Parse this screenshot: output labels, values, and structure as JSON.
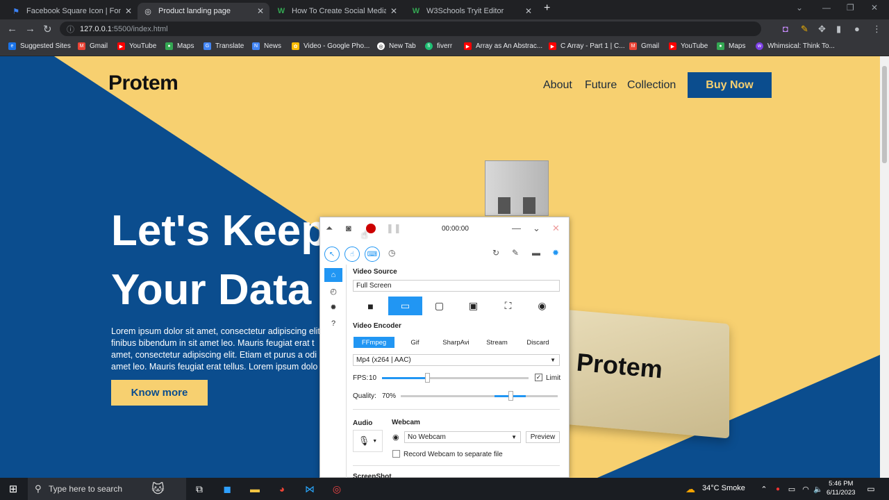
{
  "browser": {
    "tabs": [
      {
        "title": "Facebook Square Icon | Font Awe",
        "icon": "flag-icon",
        "color": "#3b82f6"
      },
      {
        "title": "Product landing page",
        "icon": "globe-icon",
        "color": "#bdc1c6"
      },
      {
        "title": "How To Create Social Media Butt",
        "icon": "w3-icon",
        "color": "#34a853"
      },
      {
        "title": "W3Schools Tryit Editor",
        "icon": "w3-icon",
        "color": "#34a853"
      }
    ],
    "url": {
      "host": "127.0.0.1",
      "path": ":5500/index.html"
    },
    "bookmarks": [
      "Suggested Sites",
      "Gmail",
      "YouTube",
      "Maps",
      "Translate",
      "News",
      "Video - Google Pho...",
      "New Tab",
      "fiverr",
      "Array as An Abstrac...",
      "C Array - Part 1 | C...",
      "Gmail",
      "YouTube",
      "Maps",
      "Whimsical: Think To..."
    ]
  },
  "site": {
    "logo": "Protem",
    "nav": [
      "About",
      "Future",
      "Collection"
    ],
    "buy_label": "Buy Now",
    "hero_line1": "Let's Keep",
    "hero_line2": "Your Data",
    "lorem": "Lorem ipsum dolor sit amet, consectetur adipiscing elit finibus bibendum in sit amet leo. Mauris feugiat erat t amet, consectetur adipiscing elit. Etiam et purus a odi amet leo. Mauris feugiat erat tellus. Lorem ipsum dolo",
    "know_label": "Know more",
    "usb_text": "Protem",
    "colors": {
      "blue": "#0b4d8e",
      "yellow": "#f7d070"
    }
  },
  "recorder": {
    "timer": "00:00:00",
    "video_source_label": "Video Source",
    "video_source_value": "Full Screen",
    "video_encoder_label": "Video Encoder",
    "encoders": [
      "FFmpeg",
      "Gif",
      "SharpAvi",
      "Stream",
      "Discard"
    ],
    "format": "Mp4 (x264 | AAC)",
    "fps_label": "FPS:",
    "fps_value": "10",
    "limit_label": "Limit",
    "quality_label": "Quality:",
    "quality_value": "70%",
    "audio_label": "Audio",
    "webcam_label": "Webcam",
    "webcam_value": "No Webcam",
    "preview_label": "Preview",
    "record_webcam_label": "Record Webcam to separate file",
    "screenshot_label": "ScreenShot"
  },
  "taskbar": {
    "search_placeholder": "Type here to search",
    "weather": "34°C  Smoke",
    "time": "5:46 PM",
    "date": "6/11/2023"
  }
}
